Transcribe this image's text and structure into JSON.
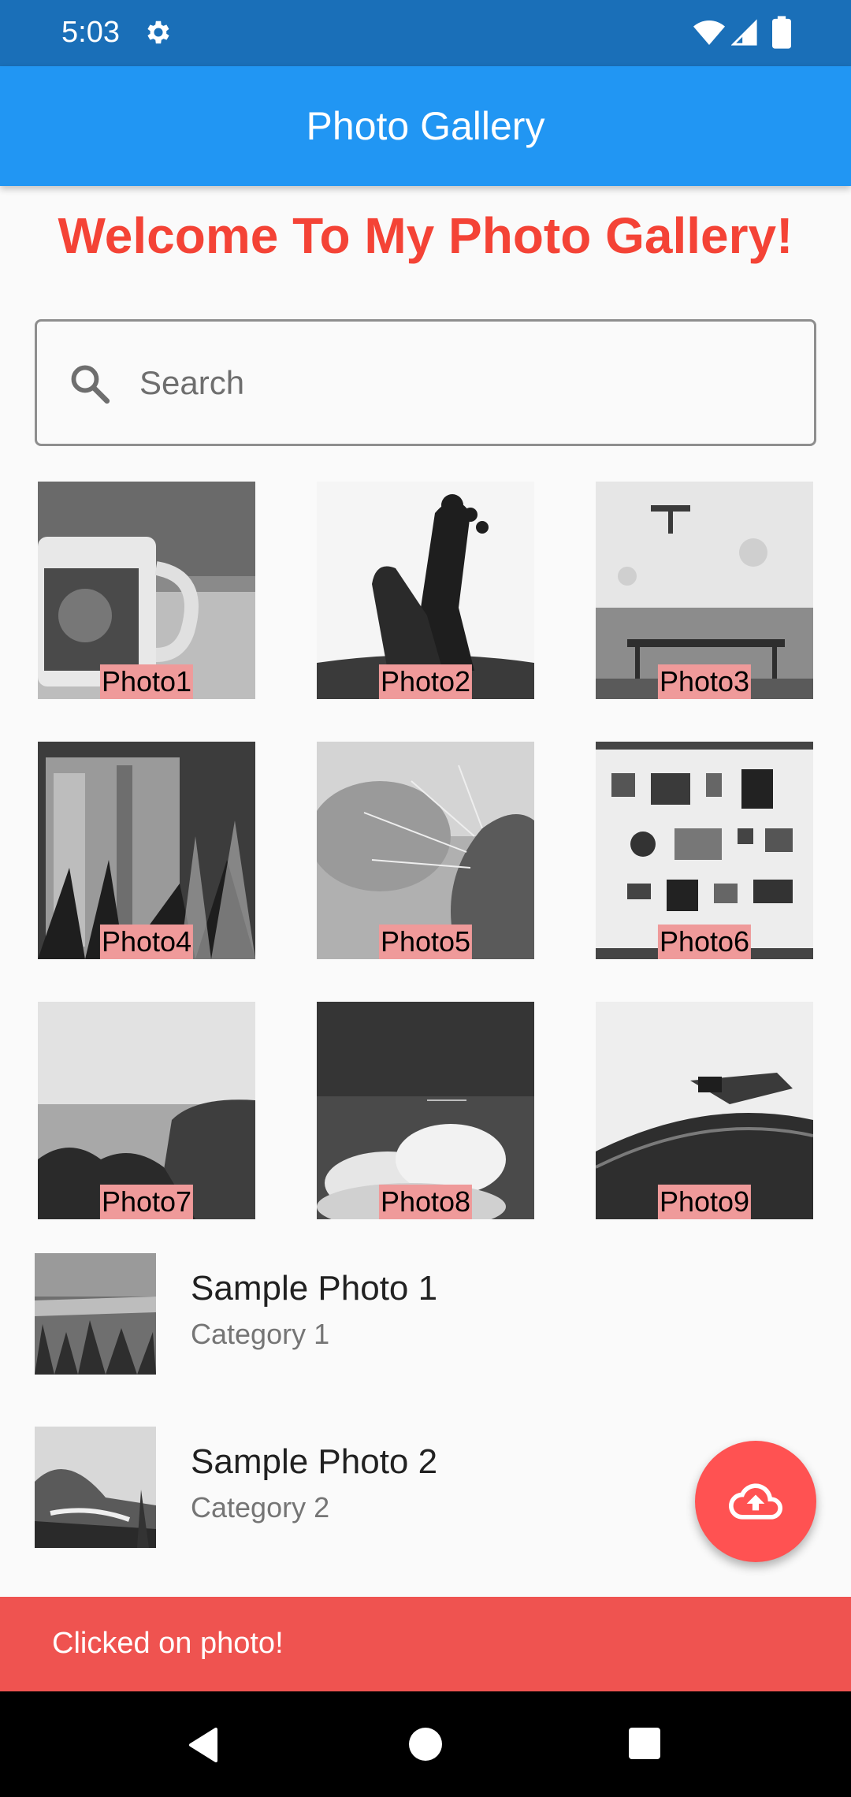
{
  "status_bar": {
    "time": "5:03",
    "icons": [
      "gear-icon",
      "wifi-icon",
      "signal-icon",
      "battery-icon"
    ]
  },
  "app_bar": {
    "title": "Photo Gallery",
    "color": "#2196F3"
  },
  "welcome": {
    "text": "Welcome To My Photo Gallery!",
    "color": "#F44336"
  },
  "search": {
    "placeholder": "Search",
    "value": ""
  },
  "grid": {
    "items": [
      {
        "label": "Photo1"
      },
      {
        "label": "Photo2"
      },
      {
        "label": "Photo3"
      },
      {
        "label": "Photo4"
      },
      {
        "label": "Photo5"
      },
      {
        "label": "Photo6"
      },
      {
        "label": "Photo7"
      },
      {
        "label": "Photo8"
      },
      {
        "label": "Photo9"
      }
    ]
  },
  "list": {
    "items": [
      {
        "title": "Sample Photo 1",
        "subtitle": "Category 1"
      },
      {
        "title": "Sample Photo 2",
        "subtitle": "Category 2"
      }
    ]
  },
  "fab": {
    "icon": "cloud-upload-icon",
    "color": "#FF5252"
  },
  "snackbar": {
    "text": "Clicked on photo!",
    "color": "#EF5350"
  },
  "nav_bar": {
    "icons": [
      "back-icon",
      "home-icon",
      "recents-icon"
    ]
  }
}
